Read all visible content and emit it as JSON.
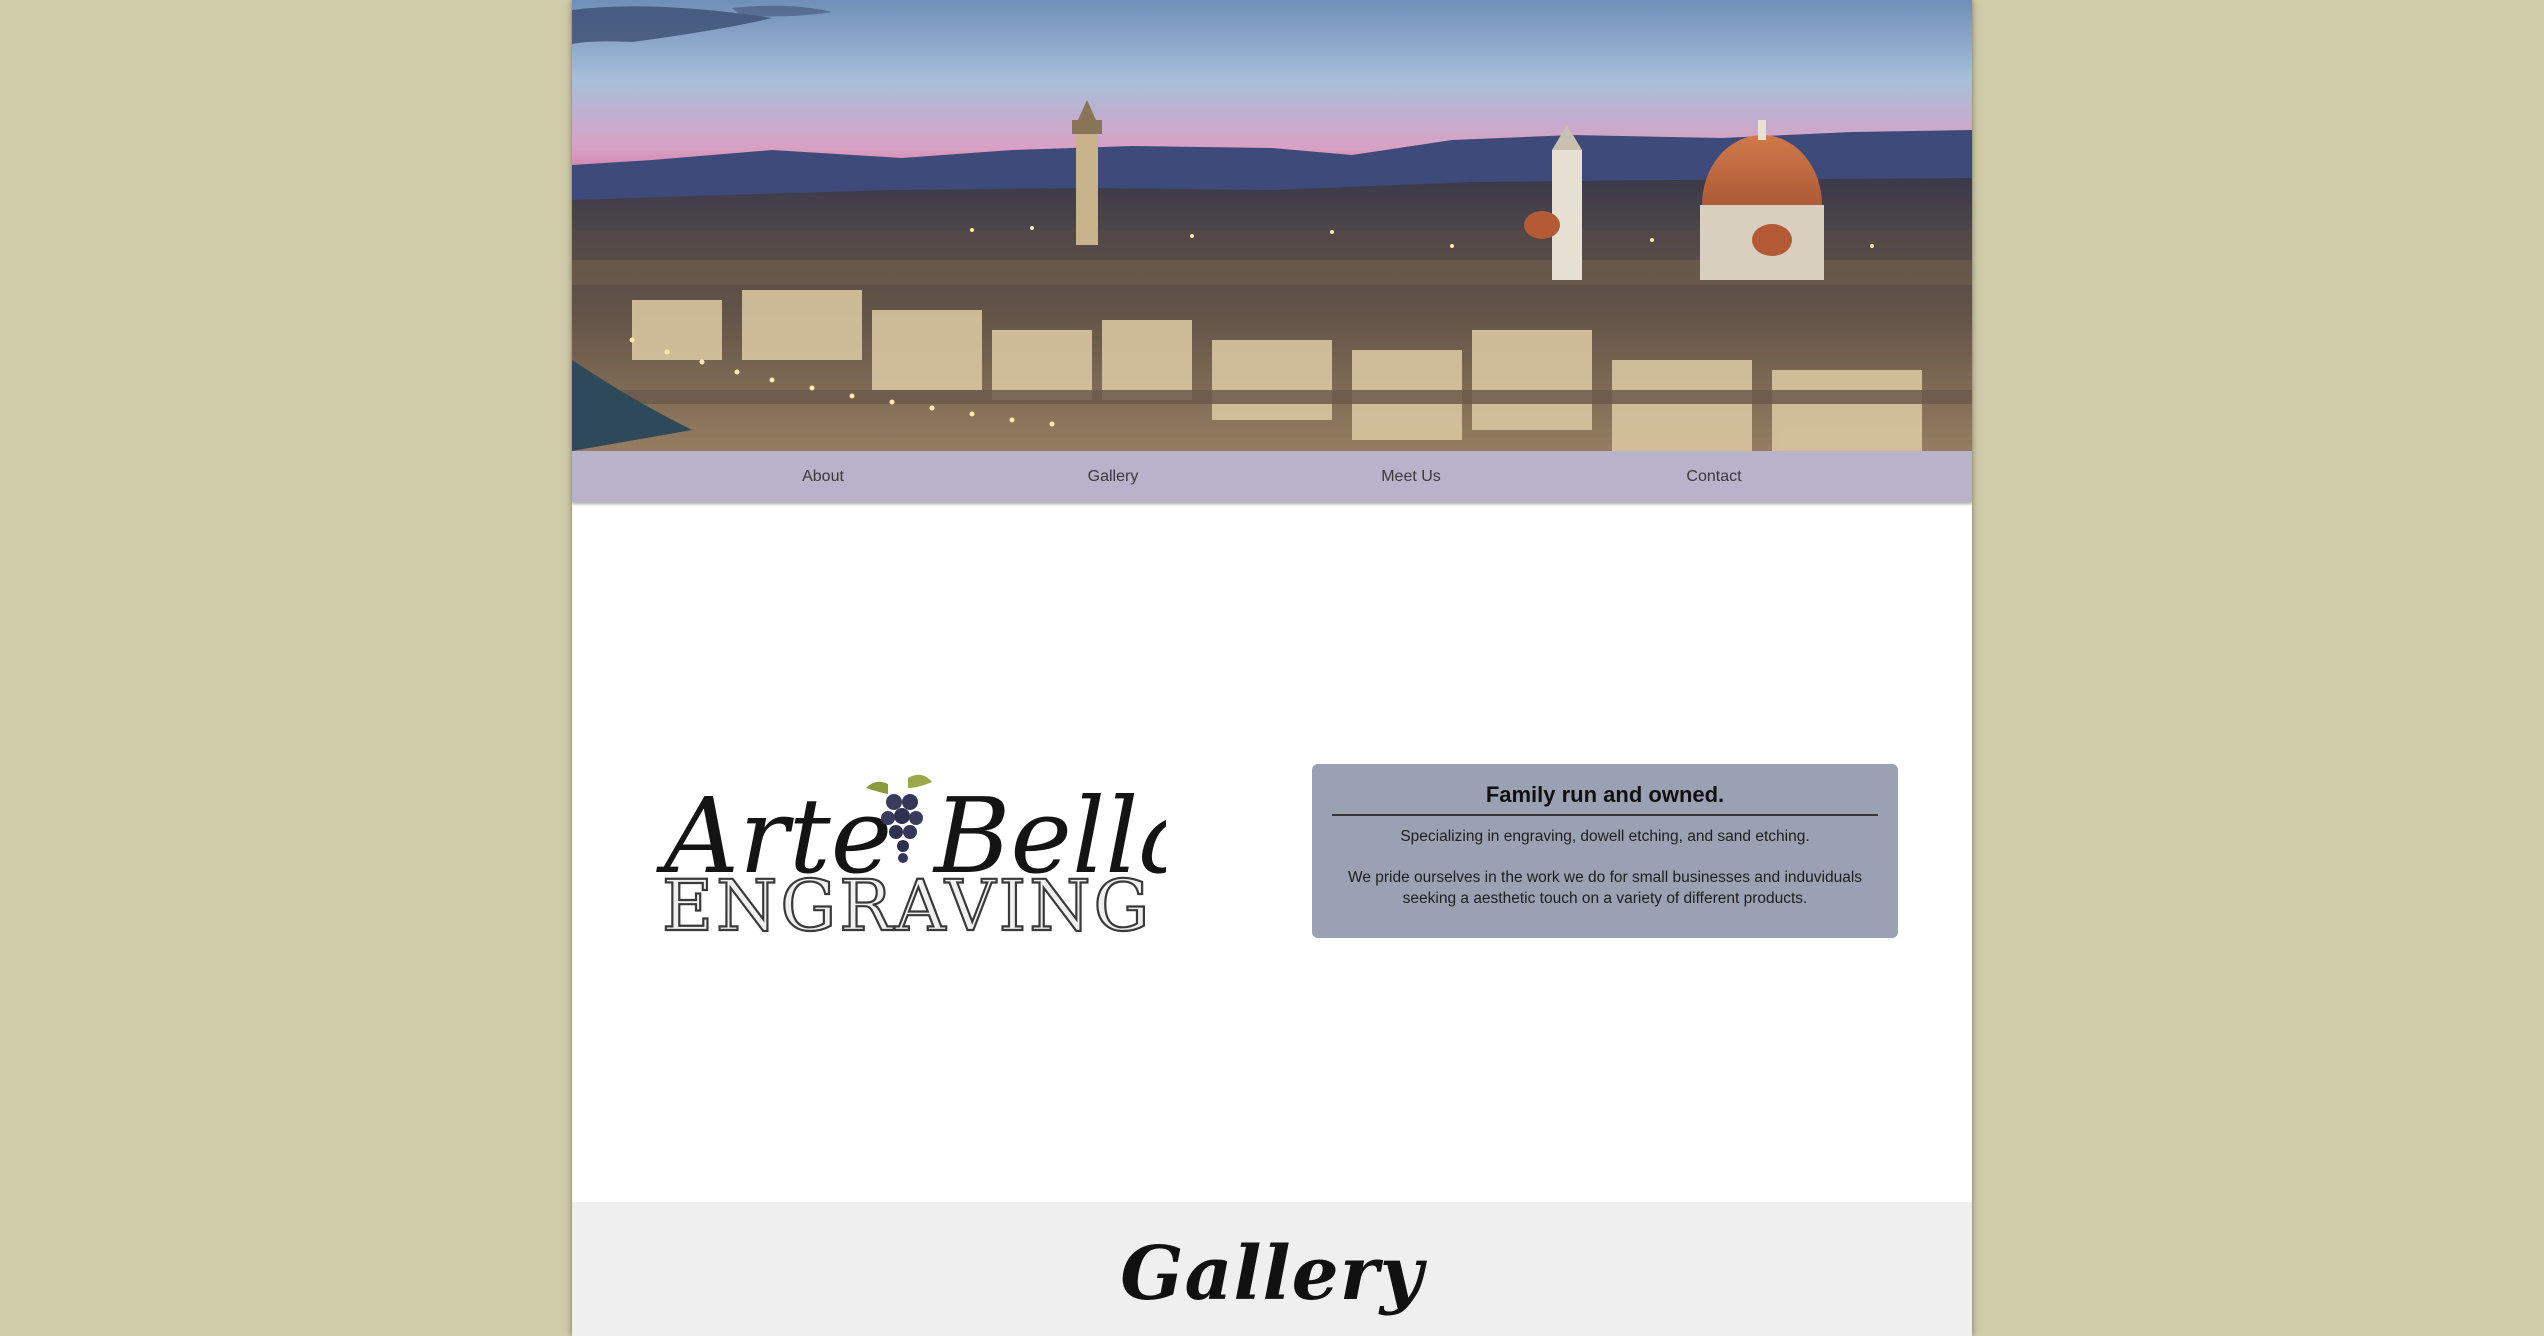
{
  "nav": {
    "items": [
      {
        "label": "About"
      },
      {
        "label": "Gallery"
      },
      {
        "label": "Meet Us"
      },
      {
        "label": "Contact"
      }
    ]
  },
  "hero": {
    "image": "florence-skyline-at-dusk"
  },
  "logo": {
    "line1": "Arte Bella",
    "line2": "ENGRAVING",
    "icon": "grape-cluster-icon"
  },
  "intro": {
    "title": "Family run and owned.",
    "paragraph1": "Specializing in engraving, dowell etching, and sand etching.",
    "paragraph2_line1": "We pride ourselves in the work we do for small businesses and induviduals",
    "paragraph2_line2": "seeking a aesthetic touch on a variety of different products."
  },
  "gallery": {
    "heading": "Gallery"
  },
  "colors": {
    "background": "#d0cba8",
    "nav": "#b8b2ca",
    "card": "#99a1b3",
    "gallery_band": "#efefef"
  }
}
